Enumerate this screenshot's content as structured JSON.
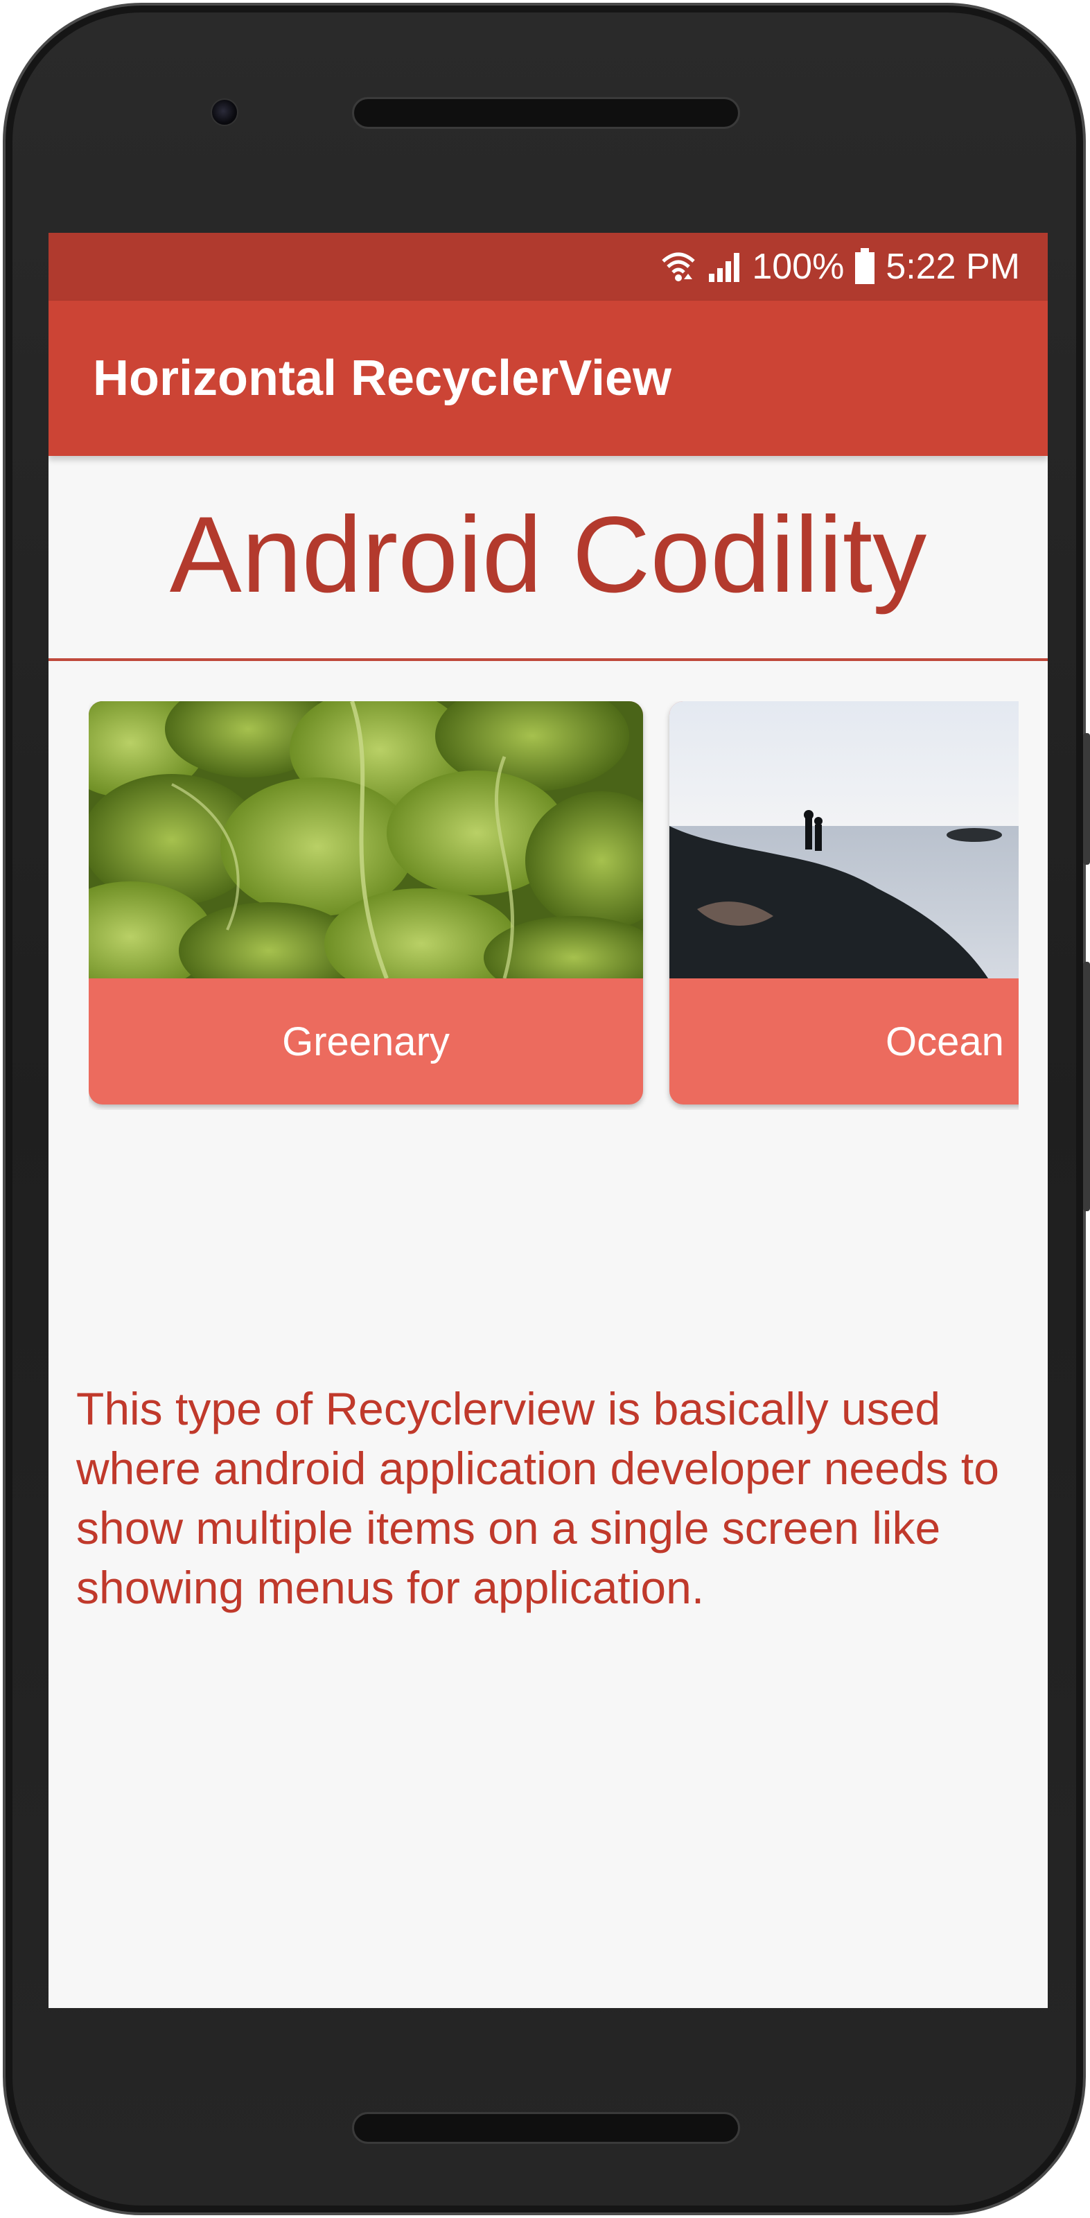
{
  "status_bar": {
    "battery_percent": "100%",
    "time": "5:22 PM",
    "icons": [
      "wifi-icon",
      "signal-icon",
      "battery-icon"
    ]
  },
  "app_bar": {
    "title": "Horizontal RecyclerView"
  },
  "header": {
    "title": "Android Codility"
  },
  "cards": [
    {
      "label": "Greenary",
      "image": "greenery-image"
    },
    {
      "label": "Ocean",
      "image": "ocean-image"
    }
  ],
  "description": "This type of Recyclerview is basically used where android application developer needs to show multiple items on a single screen like showing menus for application.",
  "colors": {
    "status_bar": "#b03a2e",
    "app_bar": "#cc4435",
    "accent_text": "#b33a2d",
    "card_background": "#ec6b5e",
    "screen_background": "#f7f7f7"
  }
}
